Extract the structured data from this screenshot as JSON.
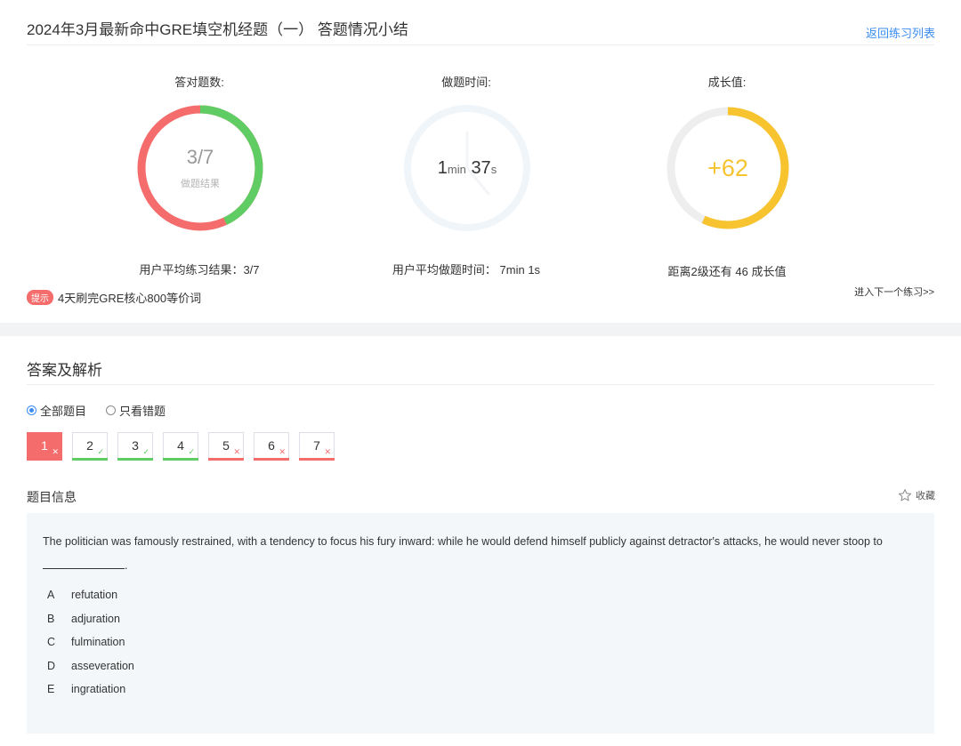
{
  "page": {
    "title": "2024年3月最新命中GRE填空机经题（一） 答题情况小结",
    "back_link": "返回练习列表"
  },
  "stats": {
    "correct": {
      "label": "答对题数:",
      "score": "3/7",
      "sub": "做题结果",
      "footer": "用户平均练习结果：3/7",
      "correct_fraction": 0.43,
      "color_correct": "#5fcd64",
      "color_wrong": "#f56c6c"
    },
    "time": {
      "label": "做题时间:",
      "minutes": "1",
      "min_unit": "min",
      "seconds": "37",
      "sec_unit": "s",
      "footer": "用户平均做题时间：  7min 1s",
      "color_ring": "#f0f5fa"
    },
    "growth": {
      "label": "成长值:",
      "value": "+62",
      "footer": "距离2级还有 46 成长值",
      "progress_fraction": 0.57,
      "color_fill": "#f7c32e",
      "color_track": "#eeeeee"
    }
  },
  "tip": {
    "badge": "提示",
    "text": "4天刷完GRE核心800等价词"
  },
  "next_link": "进入下一个练习>>",
  "answers": {
    "section_title": "答案及解析",
    "filters": [
      {
        "label": "全部题目",
        "selected": true
      },
      {
        "label": "只看错题",
        "selected": false
      }
    ],
    "questions": [
      {
        "num": "1",
        "correct": false,
        "active": true,
        "mark": "✕"
      },
      {
        "num": "2",
        "correct": true,
        "active": false,
        "mark": "✓"
      },
      {
        "num": "3",
        "correct": true,
        "active": false,
        "mark": "✓"
      },
      {
        "num": "4",
        "correct": true,
        "active": false,
        "mark": "✓"
      },
      {
        "num": "5",
        "correct": false,
        "active": false,
        "mark": "✕"
      },
      {
        "num": "6",
        "correct": false,
        "active": false,
        "mark": "✕"
      },
      {
        "num": "7",
        "correct": false,
        "active": false,
        "mark": "✕"
      }
    ],
    "info_title": "题目信息",
    "favorite": "收藏",
    "stem": "The politician was famously restrained, with a tendency to focus his fury inward: while he would defend himself publicly against detractor's attacks, he would never stoop to",
    "stem_end": ".",
    "options": [
      {
        "letter": "A",
        "text": "refutation"
      },
      {
        "letter": "B",
        "text": "adjuration"
      },
      {
        "letter": "C",
        "text": "fulmination"
      },
      {
        "letter": "D",
        "text": "asseveration"
      },
      {
        "letter": "E",
        "text": "ingratiation"
      }
    ]
  },
  "colors": {
    "accent": "#3b8cf0",
    "correct": "#5fcd64",
    "wrong": "#f56c6c",
    "growth": "#f7c32e"
  }
}
